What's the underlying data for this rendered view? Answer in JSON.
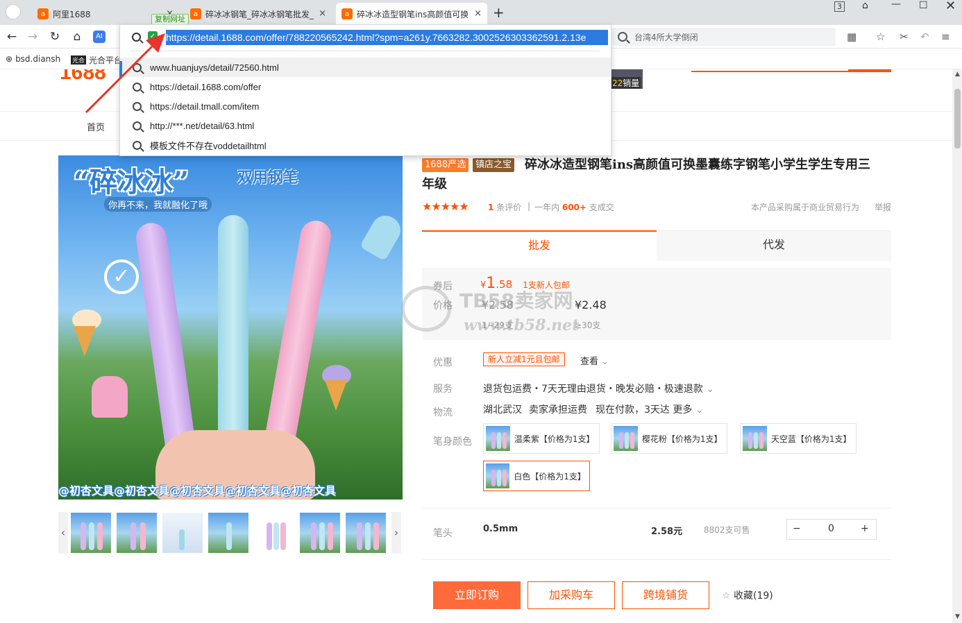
{
  "browser": {
    "tabs": [
      {
        "title": "阿里1688",
        "icon": "1688-favicon"
      },
      {
        "title": "碎冰冰钢笔_碎冰冰钢笔批发_",
        "icon": "1688-favicon"
      },
      {
        "title": "碎冰冰造型钢笔ins高颜值可换",
        "icon": "1688-favicon"
      }
    ],
    "copy_tag": "复制网址",
    "new_tab": "+",
    "window_badge": "3",
    "address_url": "https://detail.1688.com/offer/788220565242.html?spm=a261y.7663282.3002526303362591.2.13e",
    "search_box_text": "台湾4所大学倒闭",
    "bookmarks": [
      {
        "label": "bsd.diansh",
        "icon": "globe-icon"
      },
      {
        "label": "光合平台",
        "icon": "guanghe-icon"
      }
    ],
    "suggestions": [
      "www.huanjuys/detail/72560.html",
      "https://detail.1688.com/offer",
      "https://detail.tmall.com/item",
      "http://***.net/detail/63.html",
      "模板文件不存在voddetailhtml"
    ]
  },
  "page": {
    "logo": "1688",
    "sales_label": "销量",
    "sales_badge_num": "22",
    "nav_home": "首页",
    "image": {
      "title": "“碎冰冰”",
      "subtitle": "双用钢笔",
      "slogan": "你再不来，我就融化了哦",
      "watermark": "@初杏文具@初杏文具@初杏文具@初杏文具@初杏文具"
    },
    "badges": [
      "1688严选",
      "镇店之宝"
    ],
    "title": "碎冰冰造型钢笔ins高颜值可换墨囊练字钢笔小学生学生专用三年级",
    "rating_stars": "★★★★★",
    "review_count": "1",
    "review_label": "条评价",
    "sold_prefix": "一年内",
    "sold_count": "600+",
    "sold_suffix": "支成交",
    "trade_note": "本产品采购属于商业贸易行为",
    "report": "举报",
    "tabs": [
      "批发",
      "代发"
    ],
    "price": {
      "coupon_label": "券后",
      "coupon_price_symbol": "¥",
      "coupon_price_int": "1",
      "coupon_price_dec": ".58",
      "coupon_note": "1支新人包邮",
      "price_label": "价格",
      "tier1_price": "¥2.58",
      "tier1_qty": "1~29支",
      "tier2_price": "¥2.48",
      "tier2_qty": "≥30支",
      "wm_text1": "TB58卖家网",
      "wm_text2": "www.tb58.net"
    },
    "promo_label": "优惠",
    "promo_coupon": "新人立减1元且包邮",
    "promo_view": "查看",
    "service_label": "服务",
    "service_text": "退货包运费・7天无理由退货・晚发必赔・极速退款",
    "logistics_label": "物流",
    "logistics_from": "湖北武汉",
    "logistics_fee": "卖家承担运费",
    "logistics_eta": "现在付款，3天达 更多",
    "color_label": "笔身颜色",
    "colors": [
      "温柔紫【价格为1支】",
      "樱花粉【价格为1支】",
      "天空蓝【价格为1支】",
      "白色【价格为1支】"
    ],
    "tip_label": "笔头",
    "tip_value": "0.5mm",
    "tip_price": "2.58元",
    "tip_stock": "8802支可售",
    "qty": "0",
    "qty_minus": "−",
    "qty_plus": "+",
    "buttons": {
      "order": "立即订购",
      "cart": "加采购车",
      "crossborder": "跨境铺货",
      "fav": "收藏(19)"
    }
  },
  "colors": {
    "accent": "#ff5000",
    "address_highlight": "#2b7be0"
  }
}
